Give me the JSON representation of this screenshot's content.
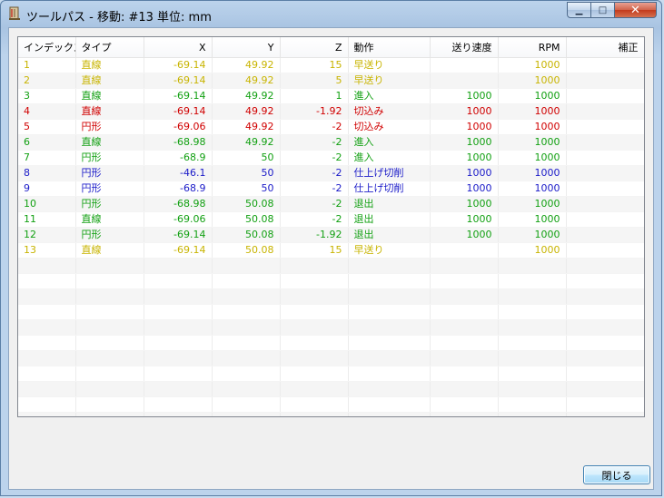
{
  "window": {
    "title": "ツールパス - 移動: #13 単位: mm"
  },
  "caption": {
    "minimize": "▁",
    "maximize": "□",
    "close": "✕"
  },
  "table": {
    "columns": [
      "インデックス",
      "タイプ",
      "X",
      "Y",
      "Z",
      "動作",
      "送り速度",
      "RPM",
      "補正"
    ],
    "rows": [
      {
        "index": "1",
        "type": "直線",
        "x": "-69.14",
        "y": "49.92",
        "z": "15",
        "action": "早送り",
        "feed": "",
        "rpm": "1000",
        "comp": "",
        "color": "#c8b400"
      },
      {
        "index": "2",
        "type": "直線",
        "x": "-69.14",
        "y": "49.92",
        "z": "5",
        "action": "早送り",
        "feed": "",
        "rpm": "1000",
        "comp": "",
        "color": "#c8b400"
      },
      {
        "index": "3",
        "type": "直線",
        "x": "-69.14",
        "y": "49.92",
        "z": "1",
        "action": "進入",
        "feed": "1000",
        "rpm": "1000",
        "comp": "",
        "color": "#12a012"
      },
      {
        "index": "4",
        "type": "直線",
        "x": "-69.14",
        "y": "49.92",
        "z": "-1.92",
        "action": "切込み",
        "feed": "1000",
        "rpm": "1000",
        "comp": "",
        "color": "#d00000"
      },
      {
        "index": "5",
        "type": "円形",
        "x": "-69.06",
        "y": "49.92",
        "z": "-2",
        "action": "切込み",
        "feed": "1000",
        "rpm": "1000",
        "comp": "",
        "color": "#d00000"
      },
      {
        "index": "6",
        "type": "直線",
        "x": "-68.98",
        "y": "49.92",
        "z": "-2",
        "action": "進入",
        "feed": "1000",
        "rpm": "1000",
        "comp": "",
        "color": "#12a012"
      },
      {
        "index": "7",
        "type": "円形",
        "x": "-68.9",
        "y": "50",
        "z": "-2",
        "action": "進入",
        "feed": "1000",
        "rpm": "1000",
        "comp": "",
        "color": "#12a012"
      },
      {
        "index": "8",
        "type": "円形",
        "x": "-46.1",
        "y": "50",
        "z": "-2",
        "action": "仕上げ切削",
        "feed": "1000",
        "rpm": "1000",
        "comp": "",
        "color": "#1a1ac8"
      },
      {
        "index": "9",
        "type": "円形",
        "x": "-68.9",
        "y": "50",
        "z": "-2",
        "action": "仕上げ切削",
        "feed": "1000",
        "rpm": "1000",
        "comp": "",
        "color": "#1a1ac8"
      },
      {
        "index": "10",
        "type": "円形",
        "x": "-68.98",
        "y": "50.08",
        "z": "-2",
        "action": "退出",
        "feed": "1000",
        "rpm": "1000",
        "comp": "",
        "color": "#12a012"
      },
      {
        "index": "11",
        "type": "直線",
        "x": "-69.06",
        "y": "50.08",
        "z": "-2",
        "action": "退出",
        "feed": "1000",
        "rpm": "1000",
        "comp": "",
        "color": "#12a012"
      },
      {
        "index": "12",
        "type": "円形",
        "x": "-69.14",
        "y": "50.08",
        "z": "-1.92",
        "action": "退出",
        "feed": "1000",
        "rpm": "1000",
        "comp": "",
        "color": "#12a012"
      },
      {
        "index": "13",
        "type": "直線",
        "x": "-69.14",
        "y": "50.08",
        "z": "15",
        "action": "早送り",
        "feed": "",
        "rpm": "1000",
        "comp": "",
        "color": "#c8b400"
      }
    ]
  },
  "buttons": {
    "close_label": "閉じる"
  }
}
